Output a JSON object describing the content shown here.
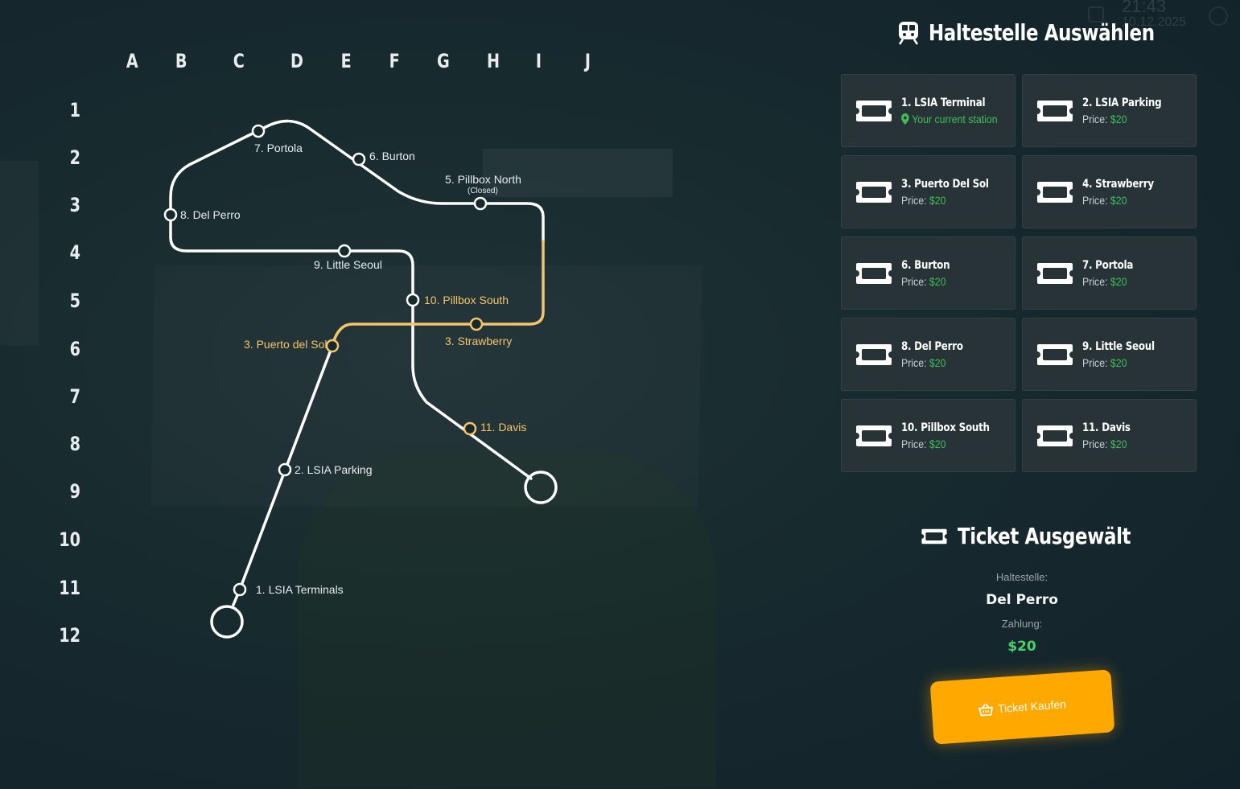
{
  "clock": {
    "time": "21:43",
    "date": "10.12.2025"
  },
  "grid": {
    "columns": [
      "A",
      "B",
      "C",
      "D",
      "E",
      "F",
      "G",
      "H",
      "I",
      "J"
    ],
    "rows": [
      "1",
      "2",
      "3",
      "4",
      "5",
      "6",
      "7",
      "8",
      "9",
      "10",
      "11",
      "12"
    ]
  },
  "map": {
    "colors": {
      "line_white": "#ffffff",
      "line_yellow": "#f6c46a"
    },
    "stations": {
      "lsia_terminals": "1. LSIA Terminals",
      "lsia_parking": "2. LSIA Parking",
      "puerto_del_sol": "3. Puerto del Sol",
      "strawberry": "3. Strawberry",
      "pillbox_north": "5. Pillbox North",
      "pillbox_north_note": "(Closed)",
      "burton": "6. Burton",
      "portola": "7. Portola",
      "del_perro": "8. Del Perro",
      "little_seoul": "9. Little Seoul",
      "pillbox_south": "10. Pillbox South",
      "davis": "11. Davis"
    }
  },
  "station_panel": {
    "title": "Haltestelle Auswählen",
    "title_icon": "train-icon",
    "price_label": "Price:",
    "cards": [
      {
        "name": "1. LSIA Terminal",
        "sub": "Your current station",
        "current": true
      },
      {
        "name": "2. LSIA Parking",
        "price": "$20"
      },
      {
        "name": "3. Puerto Del Sol",
        "price": "$20"
      },
      {
        "name": "4. Strawberry",
        "price": "$20"
      },
      {
        "name": "6. Burton",
        "price": "$20"
      },
      {
        "name": "7. Portola",
        "price": "$20"
      },
      {
        "name": "8. Del Perro",
        "price": "$20"
      },
      {
        "name": "9. Little Seoul",
        "price": "$20"
      },
      {
        "name": "10. Pillbox South",
        "price": "$20"
      },
      {
        "name": "11. Davis",
        "price": "$20"
      }
    ]
  },
  "ticket": {
    "title": "Ticket Ausgewält",
    "title_icon": "ticket-icon",
    "station_label": "Haltestelle:",
    "station_value": "Del Perro",
    "payment_label": "Zahlung:",
    "payment_value": "$20",
    "buy_label": "Ticket Kaufen",
    "buy_icon": "basket-icon",
    "accent": "#ffa800",
    "price_color": "#45d46a"
  }
}
